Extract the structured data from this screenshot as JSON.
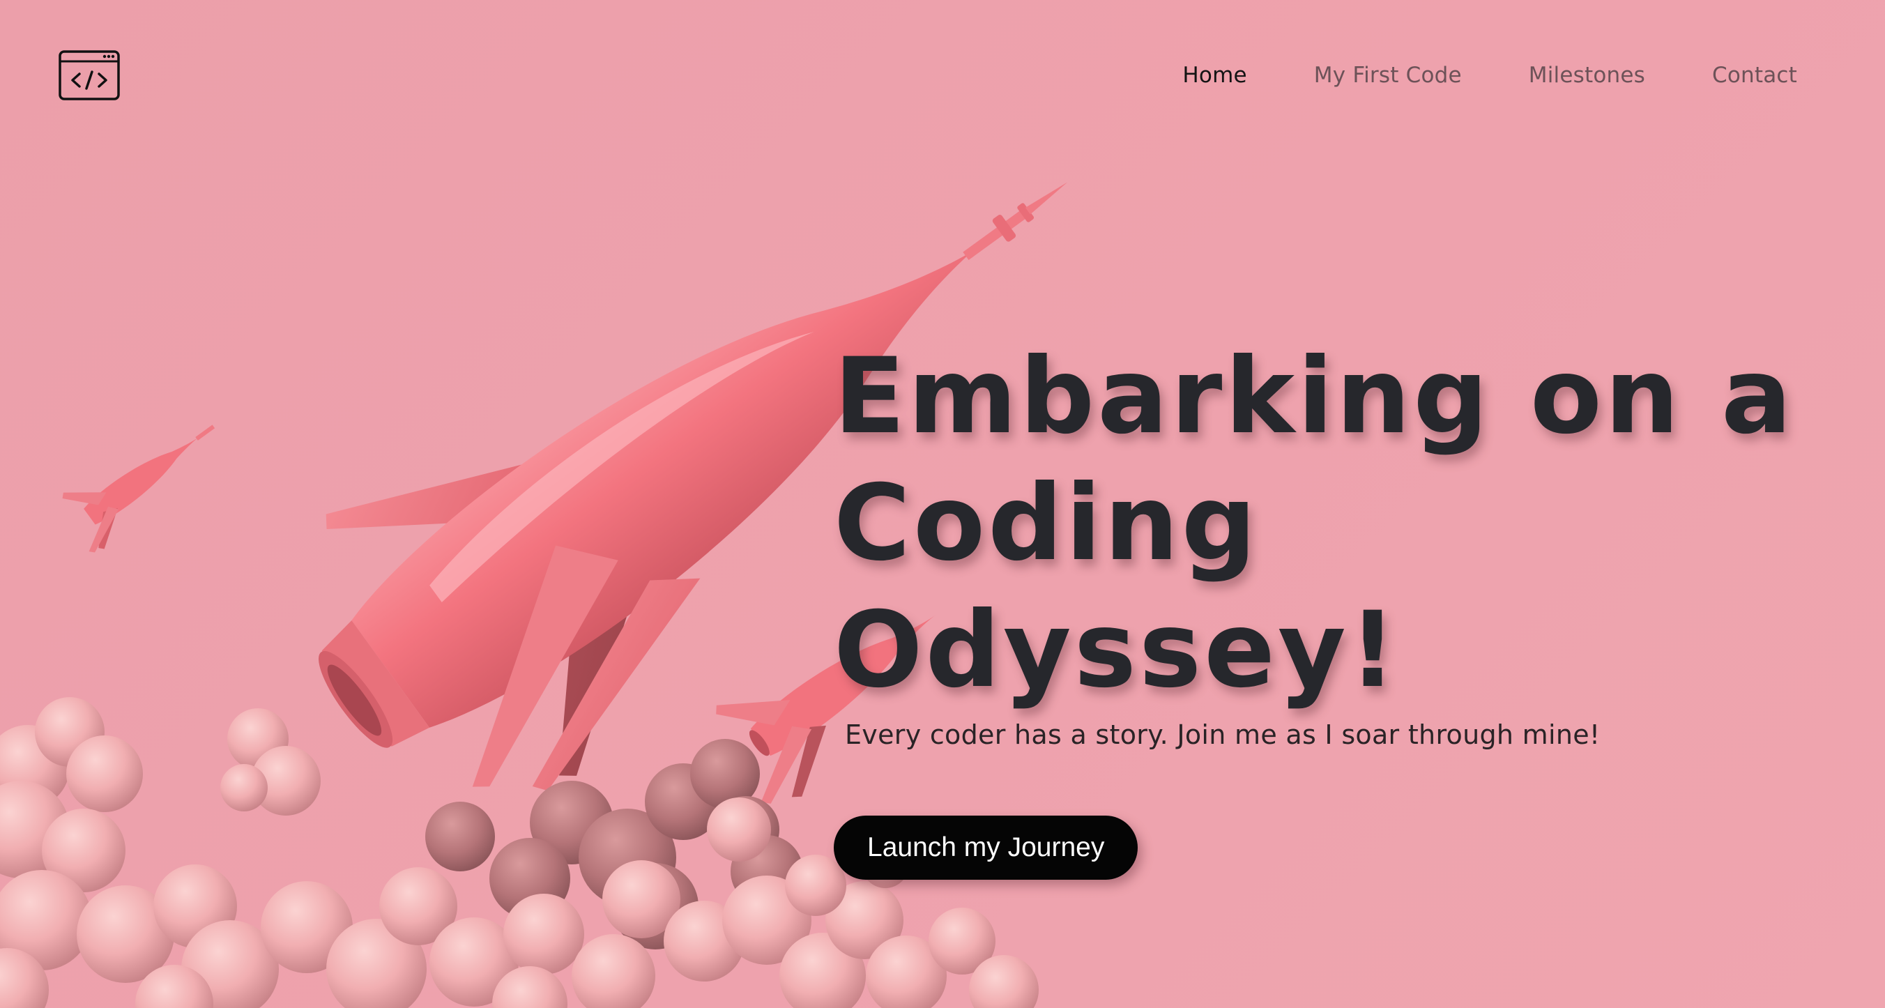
{
  "header": {
    "logo_icon": "code-window-icon",
    "nav": [
      {
        "label": "Home",
        "active": true
      },
      {
        "label": "My First Code",
        "active": false
      },
      {
        "label": "Milestones",
        "active": false
      },
      {
        "label": "Contact",
        "active": false
      }
    ]
  },
  "hero": {
    "title_lines": [
      "Embarking on a",
      "Coding",
      "Odyssey!"
    ],
    "subtitle": "Every coder has a story. Join me as I soar through mine!",
    "cta_label": "Launch my Journey"
  },
  "illustration": {
    "subject": "rocket-launch-illustration",
    "colors": {
      "background": "#EDA0AB",
      "rocket": "#F2737E",
      "smoke": "#F4B6B8",
      "title_text": "#26272C",
      "button": "#050505"
    }
  }
}
